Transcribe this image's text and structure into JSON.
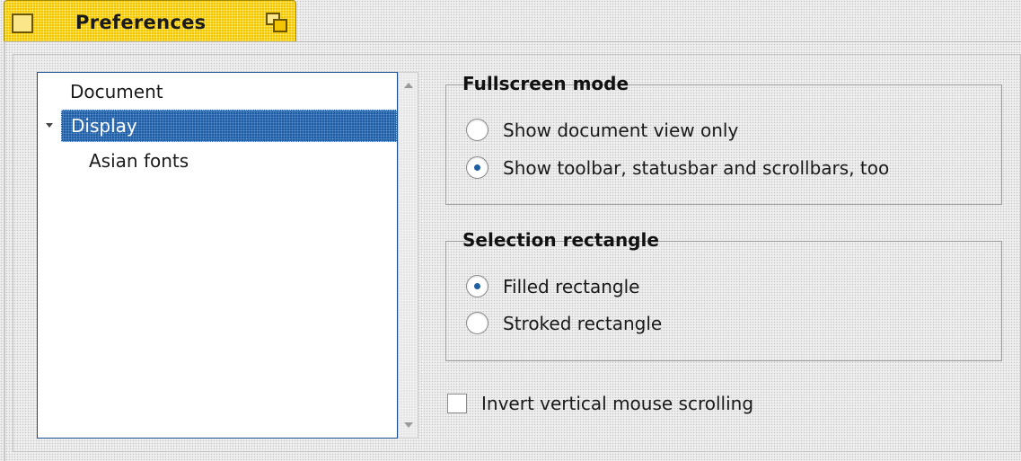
{
  "window": {
    "title": "Preferences"
  },
  "tree": {
    "items": [
      {
        "label": "Document",
        "expanded": false,
        "selected": false,
        "level": 0
      },
      {
        "label": "Display",
        "expanded": true,
        "selected": true,
        "level": 0
      },
      {
        "label": "Asian fonts",
        "expanded": false,
        "selected": false,
        "level": 1
      }
    ]
  },
  "fullscreen": {
    "title": "Fullscreen mode",
    "options": [
      {
        "label": "Show document view only",
        "checked": false
      },
      {
        "label": "Show toolbar, statusbar and scrollbars, too",
        "checked": true
      }
    ]
  },
  "selection": {
    "title": "Selection rectangle",
    "options": [
      {
        "label": "Filled rectangle",
        "checked": true
      },
      {
        "label": "Stroked rectangle",
        "checked": false
      }
    ]
  },
  "invert_scrolling": {
    "label": "Invert vertical mouse scrolling",
    "checked": false
  },
  "colors": {
    "tab": "#f4c400",
    "selection": "#1f5ea3",
    "tree_border": "#1b4f8d"
  },
  "icons": [
    "window-close-box-icon",
    "zoom-icon",
    "tree-expand-arrow-icon",
    "scroll-up-icon",
    "scroll-down-icon"
  ]
}
